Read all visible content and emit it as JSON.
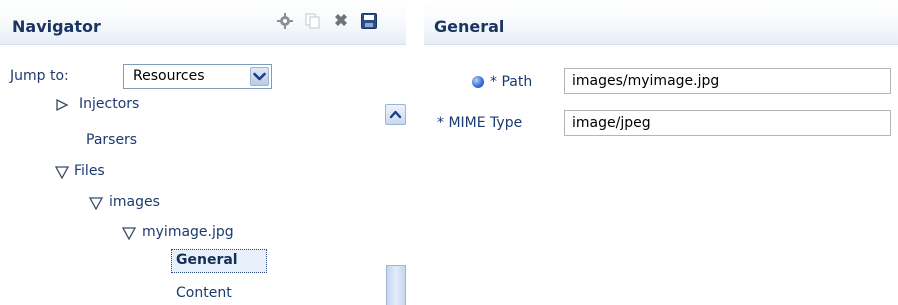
{
  "navigator": {
    "title": "Navigator",
    "jump_to": {
      "label": "Jump to:",
      "selected": "Resources"
    },
    "tree": {
      "injectors": "Injectors",
      "parsers": "Parsers",
      "files": "Files",
      "images": "images",
      "myimage": "myimage.jpg",
      "general": "General",
      "content": "Content"
    }
  },
  "general": {
    "title": "General",
    "path_label": "* Path",
    "path_value": "images/myimage.jpg",
    "mime_label": "* MIME Type",
    "mime_value": "image/jpeg"
  },
  "icons": [
    "add-icon",
    "copy-icon",
    "delete-icon",
    "save-icon",
    "info-icon"
  ],
  "colors": {
    "label_text": "#1d3a6e",
    "header_title": "#1a3560",
    "selection_bg": "#e7f0fb"
  }
}
